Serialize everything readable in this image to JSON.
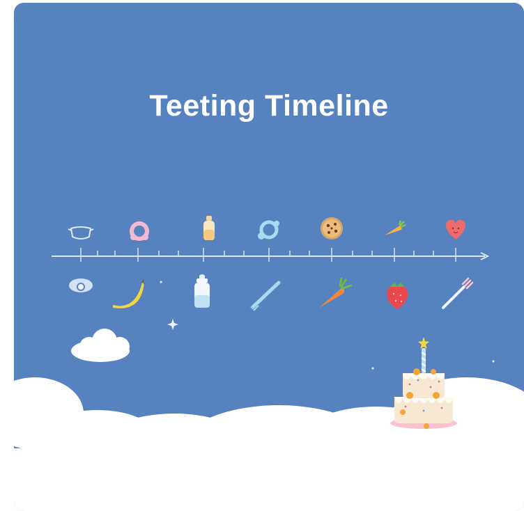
{
  "title": "Teeting Timeline",
  "colors": {
    "background": "#5683c0",
    "timeline": "#d8e4f3",
    "cloud": "#ffffff",
    "title": "#ffffff"
  },
  "timeline": {
    "top_icons": [
      "mask-teether-icon",
      "ring-teether-icon",
      "bottle-icon",
      "pacifier-ring-icon",
      "cookie-icon",
      "carrot-small-icon",
      "heart-icon"
    ],
    "bottom_icons": [
      "pacifier-icon",
      "banana-icon",
      "baby-bottle-icon",
      "spoon-icon",
      "carrot-icon",
      "strawberry-icon",
      "fork-icon"
    ],
    "decor": [
      "cloud-icon",
      "birthday-cake-icon",
      "sparkle-icon"
    ]
  }
}
